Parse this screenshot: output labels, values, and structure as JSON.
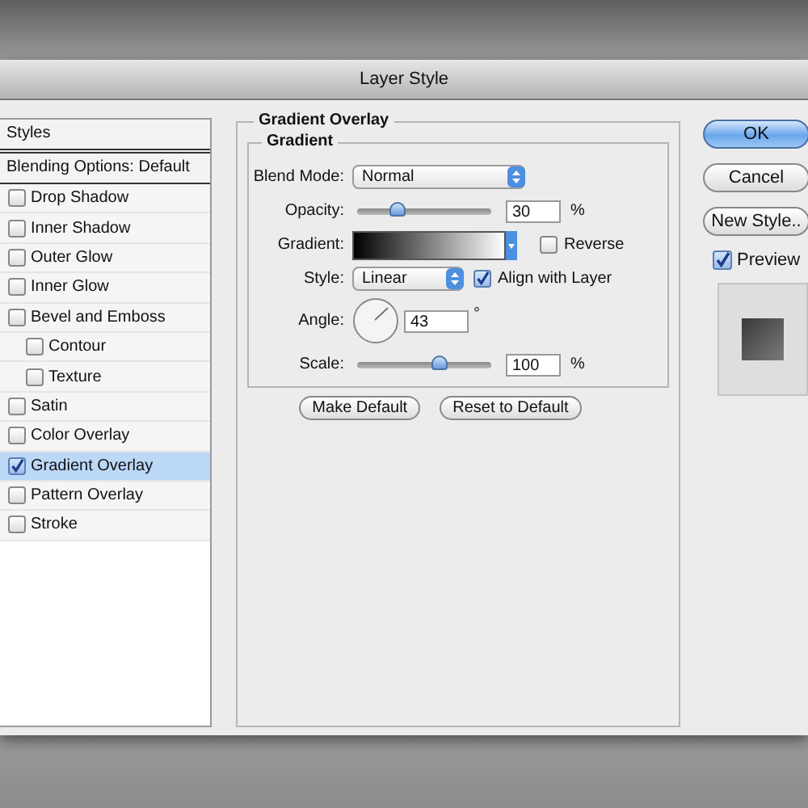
{
  "window": {
    "title": "Layer Style"
  },
  "styles_list": {
    "header": "Styles",
    "blending_options": "Blending Options: Default",
    "items": [
      {
        "label": "Drop Shadow",
        "checked": false,
        "selected": false
      },
      {
        "label": "Inner Shadow",
        "checked": false,
        "selected": false
      },
      {
        "label": "Outer Glow",
        "checked": false,
        "selected": false
      },
      {
        "label": "Inner Glow",
        "checked": false,
        "selected": false
      },
      {
        "label": "Bevel and Emboss",
        "checked": false,
        "selected": false,
        "children": [
          {
            "label": "Contour",
            "checked": false,
            "selected": false
          },
          {
            "label": "Texture",
            "checked": false,
            "selected": false
          }
        ]
      },
      {
        "label": "Satin",
        "checked": false,
        "selected": false
      },
      {
        "label": "Color Overlay",
        "checked": false,
        "selected": false
      },
      {
        "label": "Gradient Overlay",
        "checked": true,
        "selected": true
      },
      {
        "label": "Pattern Overlay",
        "checked": false,
        "selected": false
      },
      {
        "label": "Stroke",
        "checked": false,
        "selected": false
      }
    ]
  },
  "panel": {
    "title": "Gradient Overlay",
    "group": "Gradient",
    "blend_mode": {
      "label": "Blend Mode:",
      "value": "Normal"
    },
    "opacity": {
      "label": "Opacity:",
      "level": 0.3,
      "value": "30",
      "unit": "%"
    },
    "gradient": {
      "label": "Gradient:"
    },
    "reverse": {
      "label": "Reverse",
      "checked": false
    },
    "style": {
      "label": "Style:",
      "value": "Linear"
    },
    "align": {
      "label": "Align with Layer",
      "checked": true
    },
    "angle": {
      "label": "Angle:",
      "value": "43",
      "unit": "°"
    },
    "scale": {
      "label": "Scale:",
      "level": 0.61,
      "value": "100",
      "unit": "%"
    },
    "buttons": [
      "Make Default",
      "Reset to Default"
    ]
  },
  "actions": {
    "buttons": [
      {
        "label": "OK",
        "default": true
      },
      {
        "label": "Cancel",
        "default": false
      },
      {
        "label": "New Style..",
        "default": false
      }
    ],
    "preview": {
      "label": "Preview",
      "checked": true
    }
  }
}
